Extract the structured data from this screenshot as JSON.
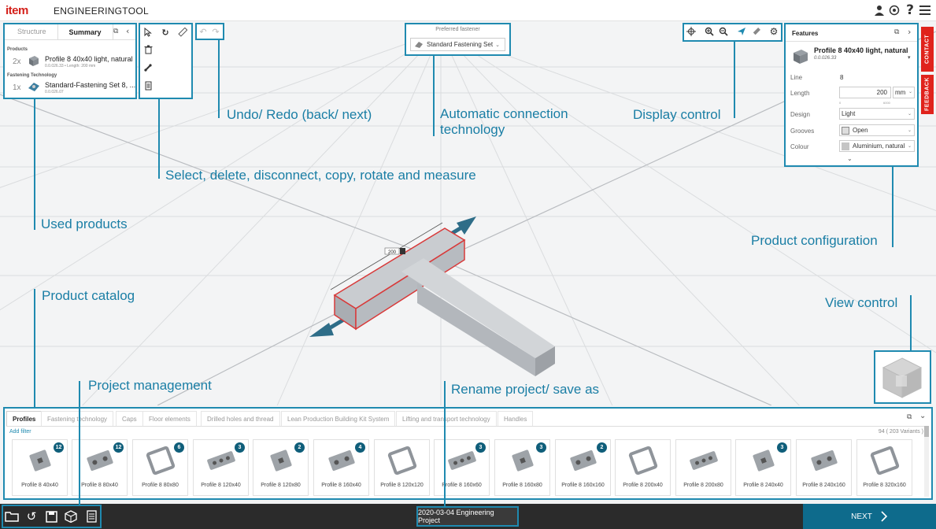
{
  "app": {
    "logo": "item",
    "title": "ENGINEERINGTOOL"
  },
  "topbar_icons": [
    "user-icon",
    "support-icon",
    "help-icon",
    "menu-icon"
  ],
  "left_panel": {
    "tabs": [
      "Structure",
      "Summary"
    ],
    "active_tab": "Summary",
    "products_heading": "Products",
    "products": [
      {
        "qty": "2x",
        "name": "Profile 8 40x40 light, natural",
        "sub": "0.0.026.33 • Length: 200 mm"
      }
    ],
    "fastening_heading": "Fastening Technology",
    "fastening": [
      {
        "qty": "1x",
        "name": "Standard-Fastening Set 8, ...",
        "sub": "0.0.026.07"
      }
    ]
  },
  "tools": [
    "select-icon",
    "rotate-icon",
    "measure-icon",
    "delete-icon",
    "disconnect-icon",
    "copy-icon"
  ],
  "fastener": {
    "label": "Preferred fastener",
    "value": "Standard Fastening Set"
  },
  "display_icons": [
    "center-icon",
    "zoom-in-icon",
    "zoom-out-icon",
    "fly-icon",
    "eraser-icon",
    "settings-icon"
  ],
  "features": {
    "title": "Features",
    "product_name": "Profile 8 40x40 light, natural",
    "product_code": "0.0.026.33",
    "rows": [
      {
        "label": "Line",
        "value": "8"
      },
      {
        "label": "Length",
        "value": "200",
        "unit": "mm",
        "min": "0",
        "max": "6000"
      },
      {
        "label": "Design",
        "value": "Light"
      },
      {
        "label": "Grooves",
        "value": "Open"
      },
      {
        "label": "Colour",
        "value": "Aluminium, natural"
      }
    ]
  },
  "side_tabs": [
    "CONTACT",
    "FEEDBACK"
  ],
  "scene": {
    "dimension_label": "200"
  },
  "annotations": {
    "undo_redo": "Undo/ Redo (back/ next)",
    "auto_connection_1": "Automatic connection",
    "auto_connection_2": "technology",
    "display_control": "Display control",
    "select_tools": "Select, delete, disconnect, copy, rotate and measure",
    "used_products": "Used products",
    "product_configuration": "Product configuration",
    "product_catalog": "Product catalog",
    "view_control": "View control",
    "project_management": "Project management",
    "rename_project": "Rename project/ save as"
  },
  "catalog": {
    "tabs": [
      "Profiles",
      "Fastening technology",
      "Caps",
      "Floor elements",
      "Drilled holes and thread",
      "Lean Production Building Kit System",
      "Lifting and transport technology",
      "Handles"
    ],
    "active_tab": "Profiles",
    "add_filter": "Add filter",
    "count": "94 ( 203 Variants )",
    "items": [
      {
        "name": "Profile 8 40x40",
        "badge": "12"
      },
      {
        "name": "Profile 8 80x40",
        "badge": "12"
      },
      {
        "name": "Profile 8 80x80",
        "badge": "6"
      },
      {
        "name": "Profile 8 120x40",
        "badge": "3"
      },
      {
        "name": "Profile 8 120x80",
        "badge": "2"
      },
      {
        "name": "Profile 8 160x40",
        "badge": "4"
      },
      {
        "name": "Profile 8 120x120",
        "badge": ""
      },
      {
        "name": "Profile 8 160x60",
        "badge": "3"
      },
      {
        "name": "Profile 8 160x80",
        "badge": "3"
      },
      {
        "name": "Profile 8 160x160",
        "badge": "2"
      },
      {
        "name": "Profile 8 200x40",
        "badge": ""
      },
      {
        "name": "Profile 8 200x80",
        "badge": ""
      },
      {
        "name": "Profile 8 240x40",
        "badge": "3"
      },
      {
        "name": "Profile 8 240x160",
        "badge": ""
      },
      {
        "name": "Profile 8 320x160",
        "badge": ""
      }
    ]
  },
  "bottombar": {
    "icons": [
      "folder-icon",
      "reset-icon",
      "save-icon",
      "cube-icon",
      "document-icon"
    ],
    "project_name": "2020-03-04 Engineering Project",
    "next_label": "NEXT"
  },
  "colors": {
    "accent": "#1f8ab0",
    "brand_red": "#d4201a",
    "next_button": "#0e6b8c",
    "badge": "#0f5e7a"
  }
}
